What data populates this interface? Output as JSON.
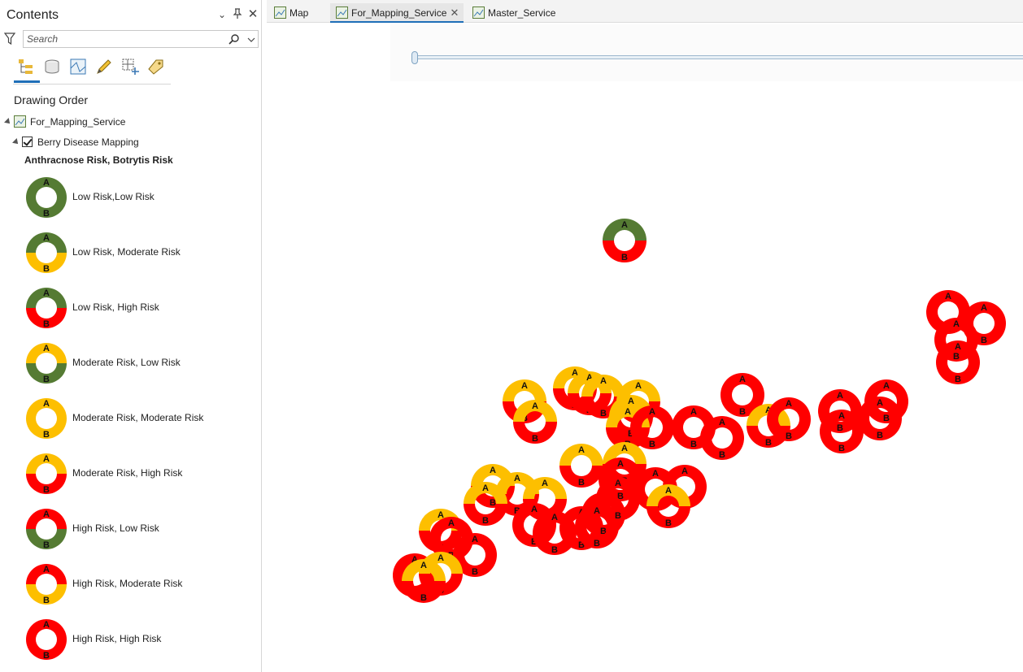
{
  "contents": {
    "title": "Contents",
    "search": {
      "placeholder": "Search"
    },
    "drawing_order": "Drawing Order",
    "map_node": "For_Mapping_Service",
    "layer": "Berry Disease Mapping",
    "layer_checked": true,
    "legend_heading": "Anthracnose Risk, Botrytis Risk",
    "legend": [
      {
        "label": "Low Risk,Low Risk",
        "a": "green",
        "b": "green"
      },
      {
        "label": "Low Risk, Moderate Risk",
        "a": "green",
        "b": "yellow"
      },
      {
        "label": "Low Risk, High Risk",
        "a": "green",
        "b": "red"
      },
      {
        "label": "Moderate Risk, Low Risk",
        "a": "yellow",
        "b": "green"
      },
      {
        "label": "Moderate Risk, Moderate Risk",
        "a": "yellow",
        "b": "yellow"
      },
      {
        "label": "Moderate Risk, High Risk",
        "a": "yellow",
        "b": "red"
      },
      {
        "label": "High Risk, Low Risk",
        "a": "red",
        "b": "green"
      },
      {
        "label": "High Risk, Moderate Risk",
        "a": "red",
        "b": "yellow"
      },
      {
        "label": "High Risk, High Risk",
        "a": "red",
        "b": "red"
      }
    ],
    "symbol_letters": {
      "top": "A",
      "bottom": "B"
    }
  },
  "tabs": [
    {
      "label": "Map",
      "active": false
    },
    {
      "label": "For_Mapping_Service",
      "active": true
    },
    {
      "label": "Master_Service",
      "active": false
    }
  ],
  "colors": {
    "green": "#557b33",
    "yellow": "#fdbf00",
    "red": "#ff0000",
    "accent": "#1f6fb8"
  },
  "map_points": [
    {
      "a": "green",
      "b": "red"
    },
    {
      "a": "red",
      "b": "red"
    },
    {
      "a": "red",
      "b": "red"
    },
    {
      "a": "red",
      "b": "red"
    },
    {
      "a": "red",
      "b": "red"
    },
    {
      "a": "yellow",
      "b": "red"
    },
    {
      "a": "yellow",
      "b": "red"
    },
    {
      "a": "yellow",
      "b": "red"
    },
    {
      "a": "yellow",
      "b": "red"
    },
    {
      "a": "yellow",
      "b": "red"
    },
    {
      "a": "yellow",
      "b": "red"
    },
    {
      "a": "yellow",
      "b": "red"
    },
    {
      "a": "yellow",
      "b": "red"
    },
    {
      "a": "red",
      "b": "red"
    },
    {
      "a": "red",
      "b": "red"
    },
    {
      "a": "red",
      "b": "red"
    },
    {
      "a": "red",
      "b": "red"
    },
    {
      "a": "yellow",
      "b": "red"
    },
    {
      "a": "red",
      "b": "red"
    },
    {
      "a": "red",
      "b": "red"
    },
    {
      "a": "red",
      "b": "red"
    },
    {
      "a": "red",
      "b": "red"
    },
    {
      "a": "red",
      "b": "red"
    },
    {
      "a": "yellow",
      "b": "red"
    },
    {
      "a": "yellow",
      "b": "red"
    },
    {
      "a": "red",
      "b": "red"
    },
    {
      "a": "yellow",
      "b": "red"
    },
    {
      "a": "yellow",
      "b": "red"
    },
    {
      "a": "yellow",
      "b": "red"
    },
    {
      "a": "yellow",
      "b": "red"
    },
    {
      "a": "yellow",
      "b": "red"
    },
    {
      "a": "red",
      "b": "red"
    },
    {
      "a": "red",
      "b": "red"
    },
    {
      "a": "red",
      "b": "red"
    },
    {
      "a": "red",
      "b": "red"
    },
    {
      "a": "red",
      "b": "red"
    },
    {
      "a": "red",
      "b": "red"
    },
    {
      "a": "red",
      "b": "red"
    },
    {
      "a": "red",
      "b": "red"
    },
    {
      "a": "red",
      "b": "red"
    },
    {
      "a": "yellow",
      "b": "red"
    },
    {
      "a": "red",
      "b": "red"
    },
    {
      "a": "yellow",
      "b": "red"
    },
    {
      "a": "yellow",
      "b": "red"
    },
    {
      "a": "red",
      "b": "red"
    }
  ]
}
